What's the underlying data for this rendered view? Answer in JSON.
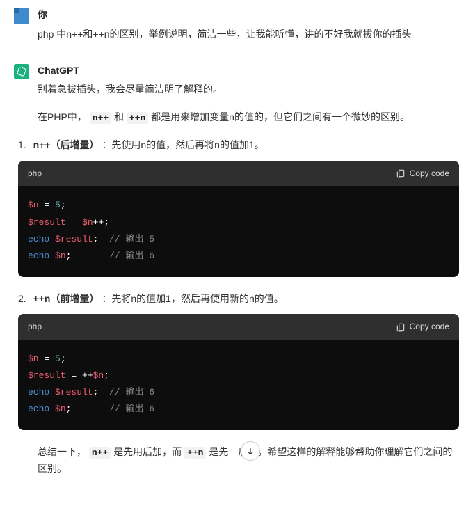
{
  "user": {
    "name": "你",
    "message": "php 中n++和++n的区别，举例说明，简洁一些，让我能听懂，讲的不好我就拔你的插头"
  },
  "assistant": {
    "name": "ChatGPT",
    "p1": "别着急拔插头，我会尽量简洁明了解释的。",
    "p2_a": "在PHP中，",
    "p2_code1": "n++",
    "p2_b": "和",
    "p2_code2": "++n",
    "p2_c": "都是用来增加变量n的值的，但它们之间有一个微妙的区别。",
    "items": [
      {
        "title": "n++（后增量）",
        "desc": " ：先使用n的值，然后再将n的值加1。",
        "lang": "php",
        "copy": "Copy code",
        "code": {
          "l1_a": "$n",
          "l1_b": " = ",
          "l1_c": "5",
          "l1_d": ";",
          "l2_a": "$result",
          "l2_b": " = ",
          "l2_c": "$n",
          "l2_d": "++;",
          "l3_a": "echo",
          "l3_b": " ",
          "l3_c": "$result",
          "l3_d": ";  ",
          "l3_e": "// 输出 5",
          "l4_a": "echo",
          "l4_b": " ",
          "l4_c": "$n",
          "l4_d": ";       ",
          "l4_e": "// 输出 6"
        }
      },
      {
        "title": "++n（前增量）",
        "desc": " ：先将n的值加1，然后再使用新的n的值。",
        "lang": "php",
        "copy": "Copy code",
        "code": {
          "l1_a": "$n",
          "l1_b": " = ",
          "l1_c": "5",
          "l1_d": ";",
          "l2_a": "$result",
          "l2_b": " = ++",
          "l2_c": "$n",
          "l2_d": ";",
          "l3_a": "echo",
          "l3_b": " ",
          "l3_c": "$result",
          "l3_d": ";  ",
          "l3_e": "// 输出 6",
          "l4_a": "echo",
          "l4_b": " ",
          "l4_c": "$n",
          "l4_d": ";       ",
          "l4_e": "// 输出 6"
        }
      }
    ],
    "final_a": "总结一下，",
    "final_code1": "n++",
    "final_b": "是先用后加，而",
    "final_code2": "++n",
    "final_c_1": "是先",
    "final_c_2": "后用。希望这样的解释能够帮助你理解它们之间的区别。"
  }
}
